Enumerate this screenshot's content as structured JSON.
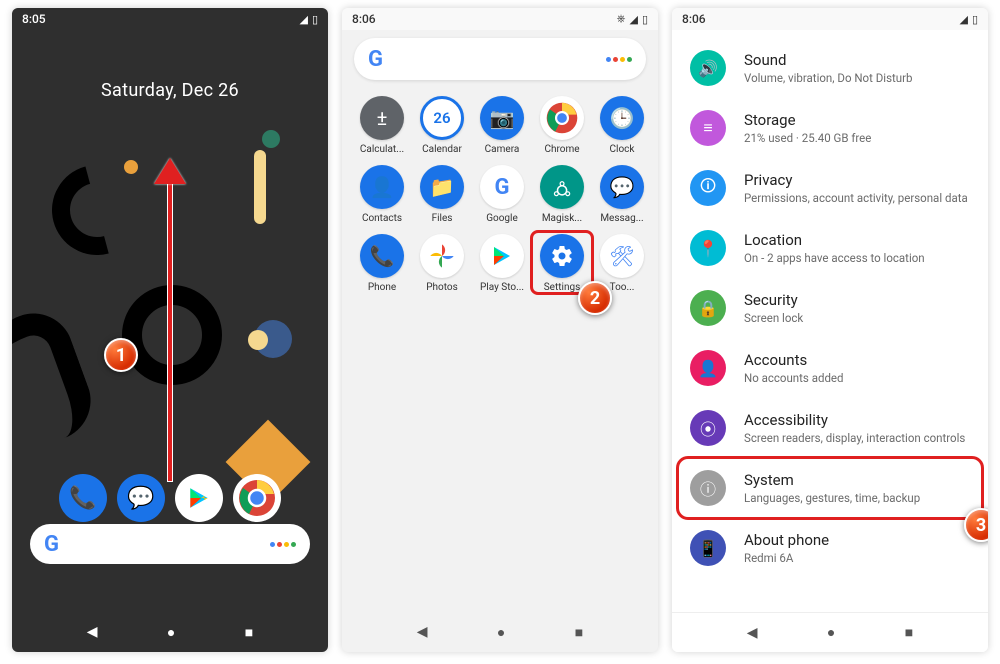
{
  "phone1": {
    "time": "8:05",
    "date": "Saturday, Dec 26",
    "dock": [
      {
        "name": "phone-app-icon",
        "bg": "#1a73e8",
        "glyph": "📞"
      },
      {
        "name": "messages-app-icon",
        "bg": "#1a73e8",
        "glyph": "💬"
      },
      {
        "name": "play-store-icon",
        "bg": "#ffffff",
        "glyph": "▶"
      },
      {
        "name": "chrome-app-icon",
        "bg": "#ffffff",
        "glyph": "◉"
      }
    ],
    "step_label": "1"
  },
  "phone2": {
    "time": "8:06",
    "apps": [
      {
        "label": "Calculat...",
        "name": "calculator-app",
        "bg": "#5f6368",
        "glyph": "±"
      },
      {
        "label": "Calendar",
        "name": "calendar-app",
        "bg": "#1a73e8",
        "glyph": "26"
      },
      {
        "label": "Camera",
        "name": "camera-app",
        "bg": "#1a73e8",
        "glyph": "📷"
      },
      {
        "label": "Chrome",
        "name": "chrome-app",
        "bg": "#ffffff",
        "glyph": "◉"
      },
      {
        "label": "Clock",
        "name": "clock-app",
        "bg": "#1a73e8",
        "glyph": "🕒"
      },
      {
        "label": "Contacts",
        "name": "contacts-app",
        "bg": "#1a73e8",
        "glyph": "👤"
      },
      {
        "label": "Files",
        "name": "files-app",
        "bg": "#1a73e8",
        "glyph": "📁"
      },
      {
        "label": "Google",
        "name": "google-app",
        "bg": "#ffffff",
        "glyph": "G"
      },
      {
        "label": "Magisk...",
        "name": "magisk-app",
        "bg": "#009688",
        "glyph": "🜛"
      },
      {
        "label": "Messag...",
        "name": "messages-app",
        "bg": "#1a73e8",
        "glyph": "💬"
      },
      {
        "label": "Phone",
        "name": "phone-app",
        "bg": "#1a73e8",
        "glyph": "📞"
      },
      {
        "label": "Photos",
        "name": "photos-app",
        "bg": "#ffffff",
        "glyph": "✦"
      },
      {
        "label": "Play Sto...",
        "name": "playstore-app",
        "bg": "#ffffff",
        "glyph": "▶"
      },
      {
        "label": "Settings",
        "name": "settings-app",
        "bg": "#1a73e8",
        "glyph": "⚙"
      },
      {
        "label": "Too...",
        "name": "tools-app",
        "bg": "#ffffff",
        "glyph": "🛠"
      }
    ],
    "highlight_index": 13,
    "step_label": "2"
  },
  "phone3": {
    "time": "8:06",
    "items": [
      {
        "name": "settings-sound",
        "icon": "🔊",
        "bg": "#00bfa5",
        "title": "Sound",
        "sub": "Volume, vibration, Do Not Disturb"
      },
      {
        "name": "settings-storage",
        "icon": "≡",
        "bg": "#c158dc",
        "title": "Storage",
        "sub": "21% used · 25.40 GB free"
      },
      {
        "name": "settings-privacy",
        "icon": "🛈",
        "bg": "#2196f3",
        "title": "Privacy",
        "sub": "Permissions, account activity, personal data"
      },
      {
        "name": "settings-location",
        "icon": "📍",
        "bg": "#00bcd4",
        "title": "Location",
        "sub": "On - 2 apps have access to location"
      },
      {
        "name": "settings-security",
        "icon": "🔒",
        "bg": "#4caf50",
        "title": "Security",
        "sub": "Screen lock"
      },
      {
        "name": "settings-accounts",
        "icon": "👤",
        "bg": "#e91e63",
        "title": "Accounts",
        "sub": "No accounts added"
      },
      {
        "name": "settings-accessibility",
        "icon": "⦿",
        "bg": "#673ab7",
        "title": "Accessibility",
        "sub": "Screen readers, display, interaction controls"
      },
      {
        "name": "settings-system",
        "icon": "ⓘ",
        "bg": "#9e9e9e",
        "title": "System",
        "sub": "Languages, gestures, time, backup"
      },
      {
        "name": "settings-about",
        "icon": "📱",
        "bg": "#3f51b5",
        "title": "About phone",
        "sub": "Redmi 6A"
      }
    ],
    "highlight_index": 7,
    "step_label": "3"
  },
  "assistant_colors": [
    "#4285F4",
    "#EA4335",
    "#FBBC05",
    "#34A853"
  ]
}
